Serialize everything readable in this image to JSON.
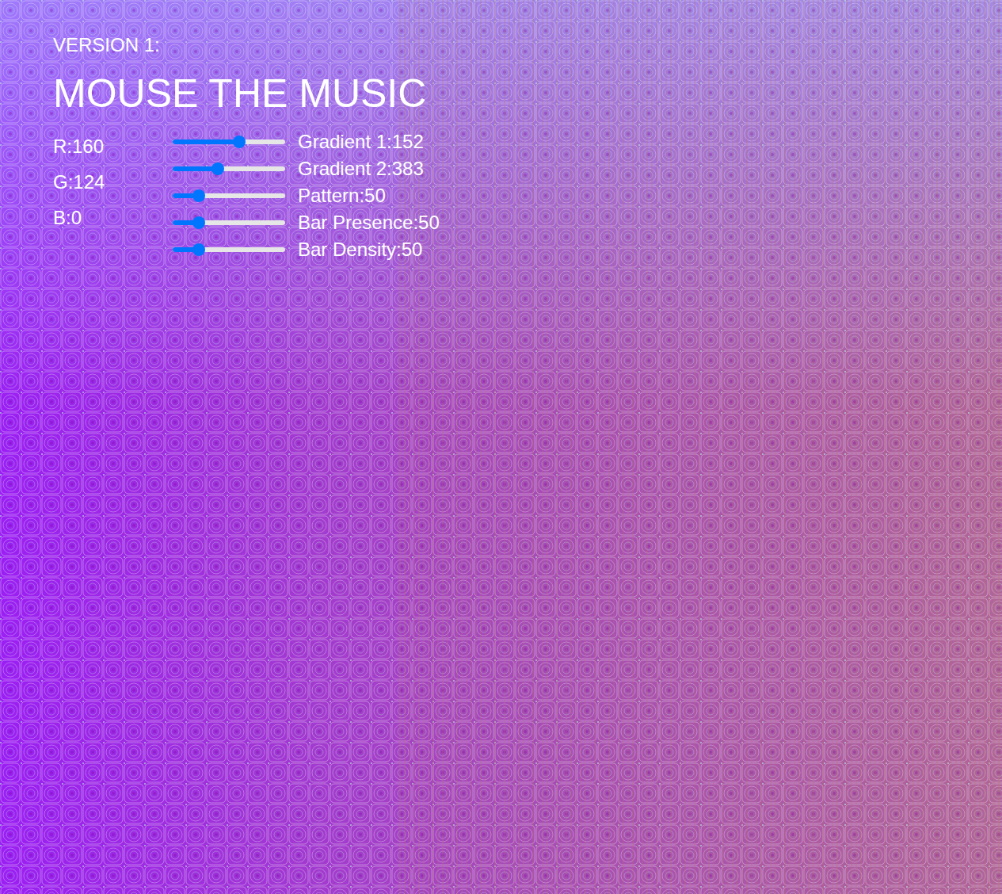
{
  "header": {
    "version": "VERSION 1:",
    "title": "MOUSE THE MUSIC"
  },
  "readouts": [
    "R:160",
    "G:124",
    "B:0"
  ],
  "sliders": [
    {
      "label": "Gradient 1:152",
      "level": 0.59
    },
    {
      "label": "Gradient 2:383",
      "level": 0.4
    },
    {
      "label": "Pattern:50",
      "level": 0.23
    },
    {
      "label": "Bar Presence:50",
      "level": 0.23
    },
    {
      "label": "Bar Density:50",
      "level": 0.23
    }
  ]
}
